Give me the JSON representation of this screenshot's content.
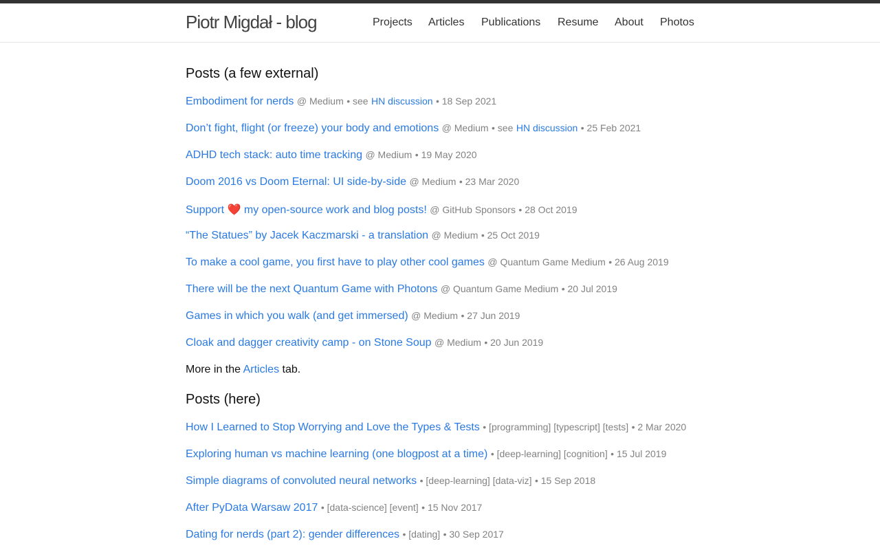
{
  "site": {
    "title": "Piotr Migdał - blog"
  },
  "nav": [
    "Projects",
    "Articles",
    "Publications",
    "Resume",
    "About",
    "Photos"
  ],
  "external": {
    "heading": "Posts (a few external)",
    "posts": [
      {
        "title": "Embodiment for nerds",
        "at": "@ Medium",
        "see": "• see",
        "link": "HN discussion",
        "date": "• 18 Sep 2021"
      },
      {
        "title": "Don’t fight, flight (or freeze) your body and emotions",
        "at": "@ Medium",
        "see": "• see",
        "link": "HN discussion",
        "date": "• 25 Feb 2021"
      },
      {
        "title": "ADHD tech stack: auto time tracking",
        "at": "@ Medium",
        "date": "• 19 May 2020"
      },
      {
        "title": "Doom 2016 vs Doom Eternal: UI side-by-side",
        "at": "@ Medium",
        "date": "• 23 Mar 2020"
      },
      {
        "title_pre": "Support",
        "heart": "❤️",
        "title_post": "my open-source work and blog posts!",
        "at": "@ GitHub Sponsors",
        "date": "• 28 Oct 2019"
      },
      {
        "title": "“The Statues” by Jacek Kaczmarski - a translation",
        "at": "@ Medium",
        "date": "• 25 Oct 2019"
      },
      {
        "title": "To make a cool game, you first have to play other cool games",
        "at": "@ Quantum Game Medium",
        "date": "• 26 Aug 2019"
      },
      {
        "title": "There will be the next Quantum Game with Photons",
        "at": "@ Quantum Game Medium",
        "date": "• 20 Jul 2019"
      },
      {
        "title": "Games in which you walk (and get immersed)",
        "at": "@ Medium",
        "date": "• 27 Jun 2019"
      },
      {
        "title": "Cloak and dagger creativity camp - on Stone Soup",
        "at": "@ Medium",
        "date": "• 20 Jun 2019"
      }
    ],
    "more": {
      "pre": "More in the",
      "link": "Articles",
      "post": "tab."
    }
  },
  "here": {
    "heading": "Posts (here)",
    "posts": [
      {
        "title": "How I Learned to Stop Worrying and Love the Types & Tests",
        "tags": "• [programming] [typescript] [tests]",
        "date": "• 2 Mar 2020"
      },
      {
        "title": "Exploring human vs machine learning (one blogpost at a time)",
        "tags": "• [deep-learning] [cognition]",
        "date": "• 15 Jul 2019"
      },
      {
        "title": "Simple diagrams of convoluted neural networks",
        "tags": "• [deep-learning] [data-viz]",
        "date": "• 15 Sep 2018"
      },
      {
        "title": "After PyData Warsaw 2017",
        "tags": "• [data-science] [event]",
        "date": "• 15 Nov 2017"
      },
      {
        "title": "Dating for nerds (part 2): gender differences",
        "tags": "• [dating]",
        "date": "• 30 Sep 2017"
      }
    ]
  }
}
